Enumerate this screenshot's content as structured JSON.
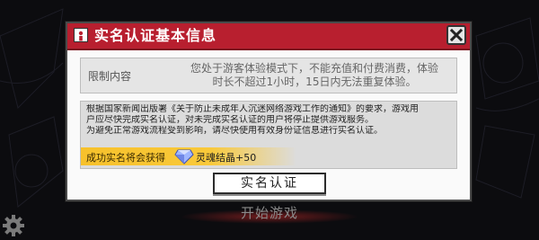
{
  "dialog": {
    "title": "实名认证基本信息",
    "limit_label": "限制内容",
    "limit_line1": "您处于游客体验模式下，不能充值和付费消费，体验",
    "limit_line2": "时长不超过1小时，15日内无法重复体验。",
    "notice_lines": [
      "根据国家新闻出版署《关于防止未成年人沉迷网络游戏工作的通知》的要求，游戏用",
      "户应尽快完成实名认证，对未完成实名认证的用户将停止提供游戏服务。",
      "为避免正常游戏流程受到影响，请尽快使用有效身份证信息进行实名认证。"
    ],
    "reward_label": "成功实名将会获得",
    "reward_item": "灵魂结晶+50",
    "verify_button": "实名认证"
  },
  "background": {
    "start_game": "开始游戏"
  },
  "icons": {
    "title": "id-card-icon",
    "close": "close-icon",
    "reward": "soul-crystal-diamond-icon",
    "settings": "gear-icon"
  },
  "colors": {
    "title_bar": "#b81f2f",
    "reward_strip": "#f7c12b"
  }
}
